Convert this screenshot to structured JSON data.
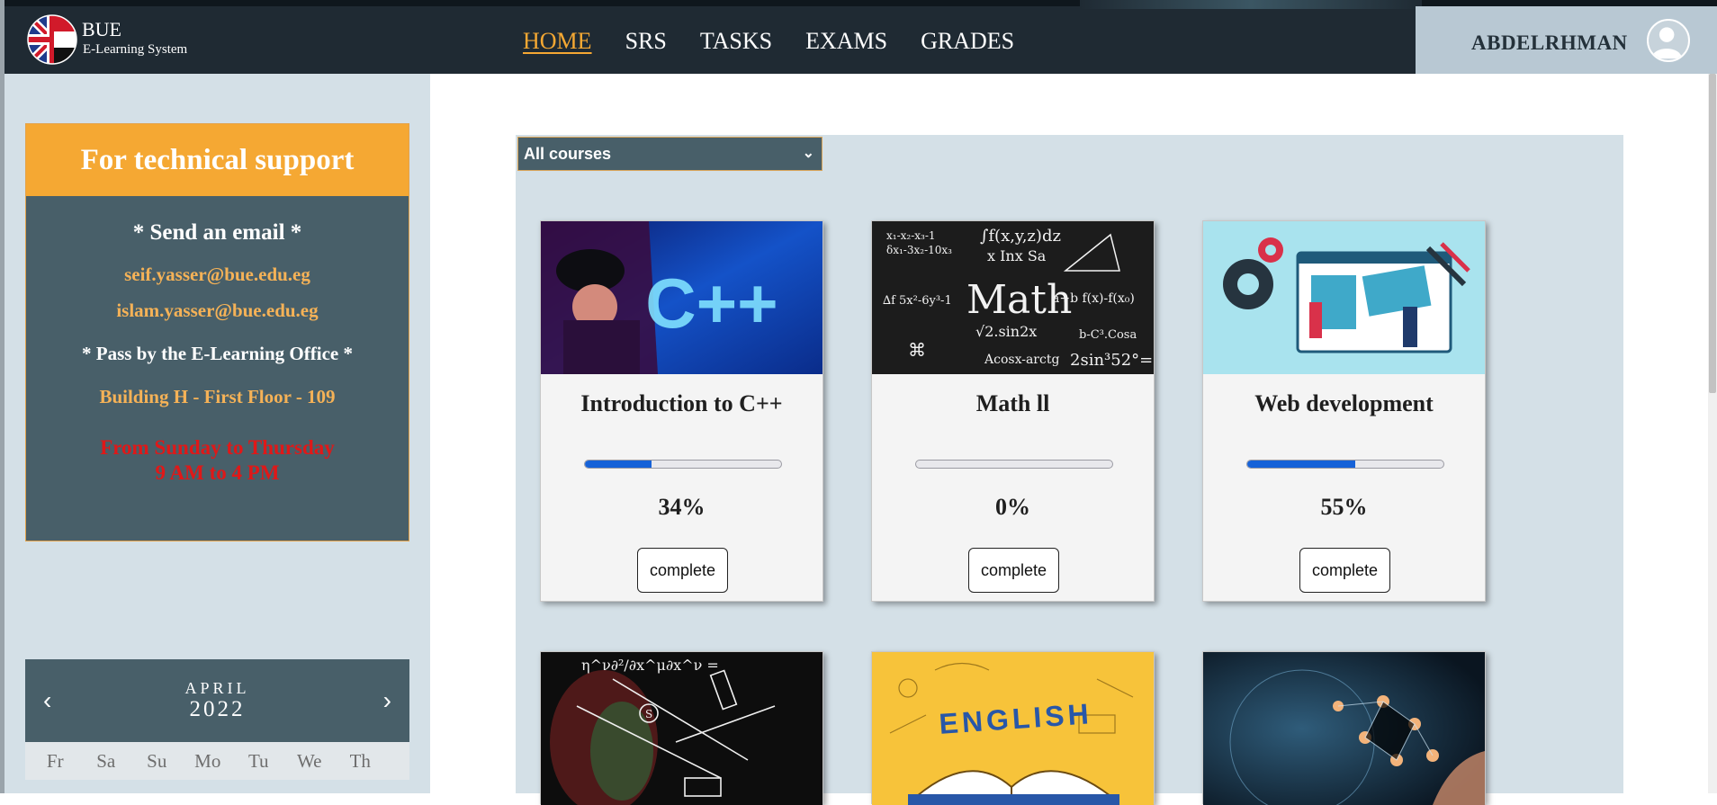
{
  "header": {
    "logo_title": "BUE",
    "logo_subtitle": "E-Learning System",
    "nav": [
      {
        "label": "HOME",
        "active": true
      },
      {
        "label": "SRS",
        "active": false
      },
      {
        "label": "TASKS",
        "active": false
      },
      {
        "label": "EXAMS",
        "active": false
      },
      {
        "label": "GRADES",
        "active": false
      }
    ],
    "user_name": "ABDELRHMAN",
    "accent_color": "#f5a833"
  },
  "support": {
    "title": "For technical support",
    "email_heading": "* Send an email *",
    "emails": [
      "seif.yasser@bue.edu.eg",
      "islam.yasser@bue.edu.eg"
    ],
    "office_heading": "* Pass by the E-Learning Office *",
    "office_location": "Building H - First Floor - 109",
    "hours_days": "From Sunday to Thursday",
    "hours_time": "9 AM to 4 PM"
  },
  "calendar": {
    "month": "APRIL",
    "year": "2022",
    "prev": "‹",
    "next": "›",
    "weekdays": [
      "Fr",
      "Sa",
      "Su",
      "Mo",
      "Tu",
      "We",
      "Th"
    ]
  },
  "courses": {
    "filter_value": "All courses",
    "items": [
      {
        "title": "Introduction to C++",
        "progress": 34,
        "progress_label": "34%",
        "button": "complete",
        "image": "cpp-image"
      },
      {
        "title": "Math ll",
        "progress": 0,
        "progress_label": "0%",
        "button": "complete",
        "image": "math-image"
      },
      {
        "title": "Web development",
        "progress": 55,
        "progress_label": "55%",
        "button": "complete",
        "image": "web-image"
      },
      {
        "image": "physics-image"
      },
      {
        "image": "english-image",
        "image_text": "ENGLISH"
      },
      {
        "image": "network-image"
      }
    ]
  }
}
